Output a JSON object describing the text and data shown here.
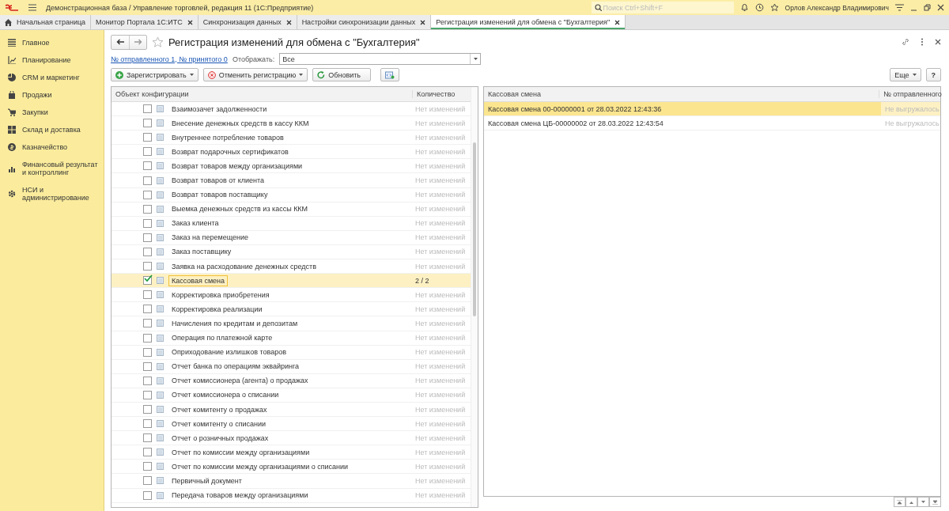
{
  "title_bar": {
    "app_title": "Демонстрационная база / Управление торговлей, редакция 11  (1С:Предприятие)",
    "search": {
      "placeholder": "Поиск Ctrl+Shift+F"
    },
    "user": "Орлов Александр Владимирович"
  },
  "tabs": [
    {
      "label": "Начальная страница",
      "kind": "home",
      "selected": false
    },
    {
      "label": "Монитор Портала 1С:ИТС",
      "kind": "closable",
      "selected": false
    },
    {
      "label": "Синхронизация данных",
      "kind": "closable",
      "selected": false
    },
    {
      "label": "Настройки синхронизации данных",
      "kind": "closable",
      "selected": false
    },
    {
      "label": "Регистрация изменений для обмена с  \"Бухгалтерия\"",
      "kind": "closable",
      "selected": true
    }
  ],
  "sidebar": {
    "items": [
      {
        "label": "Главное"
      },
      {
        "label": "Планирование"
      },
      {
        "label": "CRM и маркетинг"
      },
      {
        "label": "Продажи"
      },
      {
        "label": "Закупки"
      },
      {
        "label": "Склад и доставка"
      },
      {
        "label": "Казначейство"
      },
      {
        "label": "Финансовый результат и контроллинг"
      },
      {
        "label": "НСИ и администрирование"
      }
    ]
  },
  "form": {
    "title": "Регистрация изменений для обмена с  \"Бухгалтерия\"",
    "link": "№ отправленного 1, № принятого 0",
    "filter_label": "Отображать:",
    "filter_value": "Все",
    "buttons": [
      {
        "label": "Зарегистрировать",
        "kind": "add"
      },
      {
        "label": "Отменить регистрацию",
        "kind": "cancel"
      },
      {
        "label": "Обновить",
        "kind": "refresh"
      }
    ],
    "more_button": "Еще",
    "help_button": "?"
  },
  "objects_table": {
    "columns": [
      "Объект конфигурации",
      "Количество"
    ],
    "rows": [
      {
        "name": "Взаимозачет задолженности",
        "count": "Нет изменений",
        "checked": false,
        "selected": false
      },
      {
        "name": "Внесение денежных средств в кассу ККМ",
        "count": "Нет изменений",
        "checked": false,
        "selected": false
      },
      {
        "name": "Внутреннее потребление товаров",
        "count": "Нет изменений",
        "checked": false,
        "selected": false
      },
      {
        "name": "Возврат подарочных сертификатов",
        "count": "Нет изменений",
        "checked": false,
        "selected": false
      },
      {
        "name": "Возврат товаров между организациями",
        "count": "Нет изменений",
        "checked": false,
        "selected": false
      },
      {
        "name": "Возврат товаров от клиента",
        "count": "Нет изменений",
        "checked": false,
        "selected": false
      },
      {
        "name": "Возврат товаров поставщику",
        "count": "Нет изменений",
        "checked": false,
        "selected": false
      },
      {
        "name": "Выемка денежных средств из кассы ККМ",
        "count": "Нет изменений",
        "checked": false,
        "selected": false
      },
      {
        "name": "Заказ клиента",
        "count": "Нет изменений",
        "checked": false,
        "selected": false
      },
      {
        "name": "Заказ на перемещение",
        "count": "Нет изменений",
        "checked": false,
        "selected": false
      },
      {
        "name": "Заказ поставщику",
        "count": "Нет изменений",
        "checked": false,
        "selected": false
      },
      {
        "name": "Заявка на расходование денежных средств",
        "count": "Нет изменений",
        "checked": false,
        "selected": false
      },
      {
        "name": "Кассовая смена",
        "count": "2 / 2",
        "checked": true,
        "selected": true
      },
      {
        "name": "Корректировка приобретения",
        "count": "Нет изменений",
        "checked": false,
        "selected": false
      },
      {
        "name": "Корректировка реализации",
        "count": "Нет изменений",
        "checked": false,
        "selected": false
      },
      {
        "name": "Начисления по кредитам и депозитам",
        "count": "Нет изменений",
        "checked": false,
        "selected": false
      },
      {
        "name": "Операция по платежной карте",
        "count": "Нет изменений",
        "checked": false,
        "selected": false
      },
      {
        "name": "Оприходование излишков товаров",
        "count": "Нет изменений",
        "checked": false,
        "selected": false
      },
      {
        "name": "Отчет банка по операциям эквайринга",
        "count": "Нет изменений",
        "checked": false,
        "selected": false
      },
      {
        "name": "Отчет комиссионера (агента) о продажах",
        "count": "Нет изменений",
        "checked": false,
        "selected": false
      },
      {
        "name": "Отчет комиссионера о списании",
        "count": "Нет изменений",
        "checked": false,
        "selected": false
      },
      {
        "name": "Отчет комитенту о продажах",
        "count": "Нет изменений",
        "checked": false,
        "selected": false
      },
      {
        "name": "Отчет комитенту о списании",
        "count": "Нет изменений",
        "checked": false,
        "selected": false
      },
      {
        "name": "Отчет о розничных продажах",
        "count": "Нет изменений",
        "checked": false,
        "selected": false
      },
      {
        "name": "Отчет по комиссии между организациями",
        "count": "Нет изменений",
        "checked": false,
        "selected": false
      },
      {
        "name": "Отчет по комиссии между организациями о списании",
        "count": "Нет изменений",
        "checked": false,
        "selected": false
      },
      {
        "name": "Первичный документ",
        "count": "Нет изменений",
        "checked": false,
        "selected": false
      },
      {
        "name": "Передача товаров между организациями",
        "count": "Нет изменений",
        "checked": false,
        "selected": false
      }
    ]
  },
  "records_table": {
    "columns": [
      "Кассовая смена",
      "№ отправленного"
    ],
    "rows": [
      {
        "name": "Кассовая смена 00-00000001 от 28.03.2022 12:43:36",
        "sent": "Не выгружалось",
        "selected": true
      },
      {
        "name": "Кассовая смена ЦБ-00000002 от 28.03.2022 12:43:54",
        "sent": "Не выгружалось",
        "selected": false
      }
    ]
  }
}
